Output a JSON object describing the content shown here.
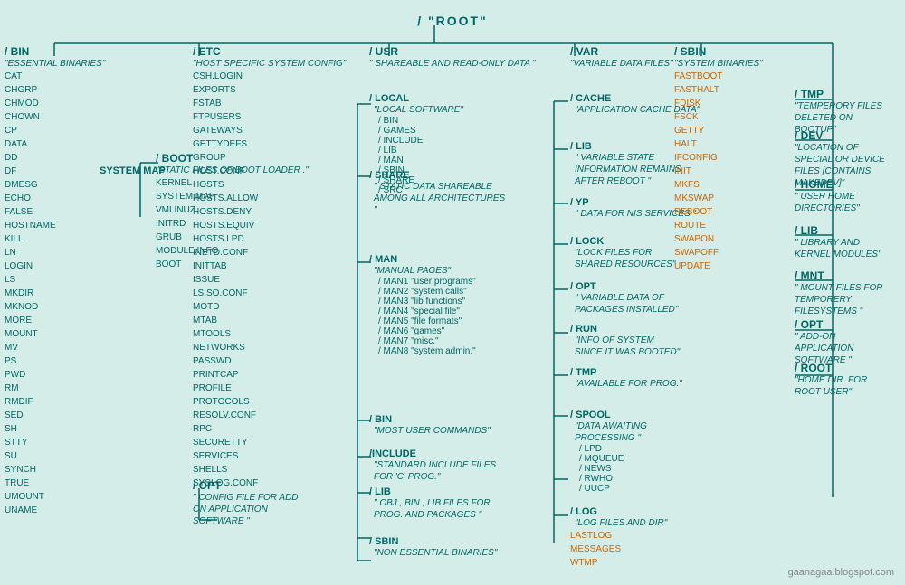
{
  "title": "/ \"ROOT\"",
  "watermark": "gaanagaa.blogspot.com",
  "systemmap": "SYSTEM MAP",
  "columns": {
    "bin": {
      "label": "/ BIN",
      "desc": "\"ESSENTIAL BINARIES\"",
      "files": [
        "CAT",
        "CHGRP",
        "CHMOD",
        "CHOWN",
        "CP",
        "DATA",
        "DD",
        "DF",
        "DMESG",
        "ECHO",
        "FALSE",
        "HOSTNAME",
        "KILL",
        "LN",
        "LOGIN",
        "LS",
        "MKDIR",
        "MKNOD",
        "MORE",
        "MOUNT",
        "MV",
        "PS",
        "PWD",
        "RM",
        "RMDIF",
        "SED",
        "SH",
        "STTY",
        "SU",
        "SYNCH",
        "TRUE",
        "UMOUNT",
        "UNAME"
      ]
    },
    "boot": {
      "label": "/ BOOT",
      "desc": "\"STATIC FILES OF BOOT LOADER .\"",
      "files": [
        "KERNEL",
        "SYSTEM.MAP",
        "VMLINUZ",
        "INITRD",
        "GRUB",
        "MODULE.INFO",
        "BOOT"
      ]
    },
    "etc": {
      "label": "/ ETC",
      "desc": "\"HOST SPECIFIC SYSTEM CONFIG\"",
      "files": [
        "CSH.LOGIN",
        "EXPORTS",
        "FSTAB",
        "FTPUSERS",
        "GATEWAYS",
        "GETTYDEFS",
        "GROUP",
        "HOST.CONF",
        "HOSTS",
        "HOSTS.ALLOW",
        "HOSTS.DENY",
        "HOSTS.EQUIV",
        "HOSTS.LPD",
        "INETD.CONF",
        "INITTAB",
        "ISSUE",
        "LS.SO.CONF",
        "MOTD",
        "MTAB",
        "MTOOLS",
        "NETWORKS",
        "PASSWD",
        "PRINTCAP",
        "PROFILE",
        "PROTOCOLS",
        "RESOLV.CONF",
        "RPC",
        "SECURETTY",
        "SERVICES",
        "SHELLS",
        "SYSLOG.CONF"
      ]
    },
    "etc_opt": {
      "label": "/ OPT",
      "desc": "\" CONFIG FILE FOR ADD ON APPLICATION SOFTWARE \""
    },
    "usr": {
      "label": "/ USR",
      "desc": "\" SHAREABLE AND READ-ONLY DATA \"",
      "local": {
        "label": "/ LOCAL",
        "desc": "\"LOCAL SOFTWARE\"",
        "sub": [
          "/ BIN",
          "/ GAMES",
          "/ INCLUDE",
          "/ LIB",
          "/ MAN",
          "/ SBIN",
          "/ SHARE",
          "/ SRC"
        ]
      },
      "share": {
        "label": "/ SHARE",
        "desc": "\" STATIC DATA SHAREABLE AMONG ALL ARCHITECTURES \""
      },
      "man": {
        "label": "/ MAN",
        "desc": "\"MANUAL PAGES\"",
        "sub": [
          "/ MAN1 \"user programs\"",
          "/ MAN2 \"system calls\"",
          "/ MAN3 \"lib functions\"",
          "/ MAN4 \"special file\"",
          "/ MAN5 \"file formats\"",
          "/ MAN6 \"games\"",
          "/ MAN7 \"misc.\"",
          "/ MAN8 \"system admin.\""
        ]
      },
      "bin": {
        "label": "/ BIN",
        "desc": "\"MOST USER COMMANDS\""
      },
      "include": {
        "label": "/INCLUDE",
        "desc": "\"STANDARD INCLUDE FILES FOR 'C' PROG.\""
      },
      "lib": {
        "label": "/ LIB",
        "desc": "\" OBJ , BIN , LIB FILES FOR PROG. AND PACKAGES \""
      },
      "sbin": {
        "label": "/ SBIN",
        "desc": "\"NON ESSENTIAL BINARIES\""
      }
    },
    "var": {
      "label": "/ VAR",
      "desc": "\"VARIABLE DATA FILES\"",
      "cache": {
        "label": "/ CACHE",
        "desc": "\"APPLICATION CACHE DATA\""
      },
      "lib": {
        "label": "/ LIB",
        "desc": "\" VARIABLE STATE INFORMATION REMAINS AFTER REBOOT \""
      },
      "yp": {
        "label": "/ YP",
        "desc": "\" DATA FOR NIS SERVICES \""
      },
      "lock": {
        "label": "/ LOCK",
        "desc": "\"LOCK FILES FOR SHARED RESOURCES\""
      },
      "opt": {
        "label": "/ OPT",
        "desc": "\" VARIABLE DATA OF PACKAGES INSTALLED\""
      },
      "run": {
        "label": "/ RUN",
        "desc": "\"INFO OF SYSTEM SINCE IT WAS BOOTED\""
      },
      "tmp": {
        "label": "/ TMP",
        "desc": "\"AVAILABLE FOR PROG.\""
      },
      "spool": {
        "label": "/ SPOOL",
        "desc": "\"DATA AWAITING PROCESSING \"",
        "sub": [
          "/ LPD",
          "/ MQUEUE",
          "/ NEWS",
          "/ RWHO",
          "/ UUCP"
        ]
      },
      "log": {
        "label": "/ LOG",
        "desc": "\"LOG FILES AND DIR\"",
        "files_orange": [
          "LASTLOG",
          "MESSAGES",
          "WTMP"
        ]
      }
    },
    "sbin": {
      "label": "/ SBIN",
      "desc": "\"SYSTEM BINARIES\"",
      "files_orange": [
        "FASTBOOT",
        "FASTHALT",
        "FDISK",
        "FSCK",
        "GETTY",
        "HALT",
        "IFCONFIG",
        "INIT",
        "MKFS",
        "MKSWAP",
        "REBOOT",
        "ROUTE",
        "SWAPON",
        "SWAPOFF",
        "UPDATE"
      ]
    },
    "right": {
      "tmp": {
        "label": "/ TMP",
        "desc": "\"TEMPERORY FILES DELETED ON BOOTUP\""
      },
      "dev": {
        "label": "/ DEV",
        "desc": "\"LOCATION OF SPECIAL OR DEVICE FILES [CONTAINS MAKEDEV]\""
      },
      "home": {
        "label": "/ HOME",
        "desc": "\" USER HOME DIRECTORIES\""
      },
      "lib": {
        "label": "/ LIB",
        "desc": "\"  LIBRARY AND KERNEL MODULES\""
      },
      "mnt": {
        "label": "/ MNT",
        "desc": "\"  MOUNT FILES FOR TEMPORERY FILESYSTEMS \""
      },
      "opt": {
        "label": "/ OPT",
        "desc": "\" ADD-ON APPLICATION SOFTWARE \""
      },
      "root": {
        "label": "/ ROOT",
        "desc": "\"HOME DIR. FOR ROOT USER\""
      }
    }
  }
}
